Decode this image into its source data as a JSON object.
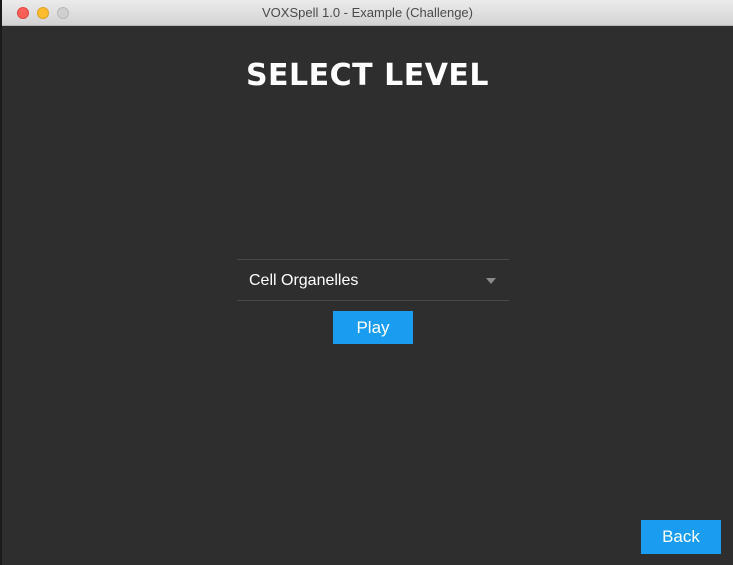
{
  "window": {
    "title": "VOXSpell 1.0 - Example (Challenge)"
  },
  "page": {
    "title": "SELECT LEVEL"
  },
  "level_select": {
    "selected_value": "Cell Organelles",
    "icon": "chevron-down-icon"
  },
  "buttons": {
    "play_label": "Play",
    "back_label": "Back"
  },
  "colors": {
    "background": "#2e2e2e",
    "accent": "#1a9df0",
    "text": "#ffffff"
  }
}
